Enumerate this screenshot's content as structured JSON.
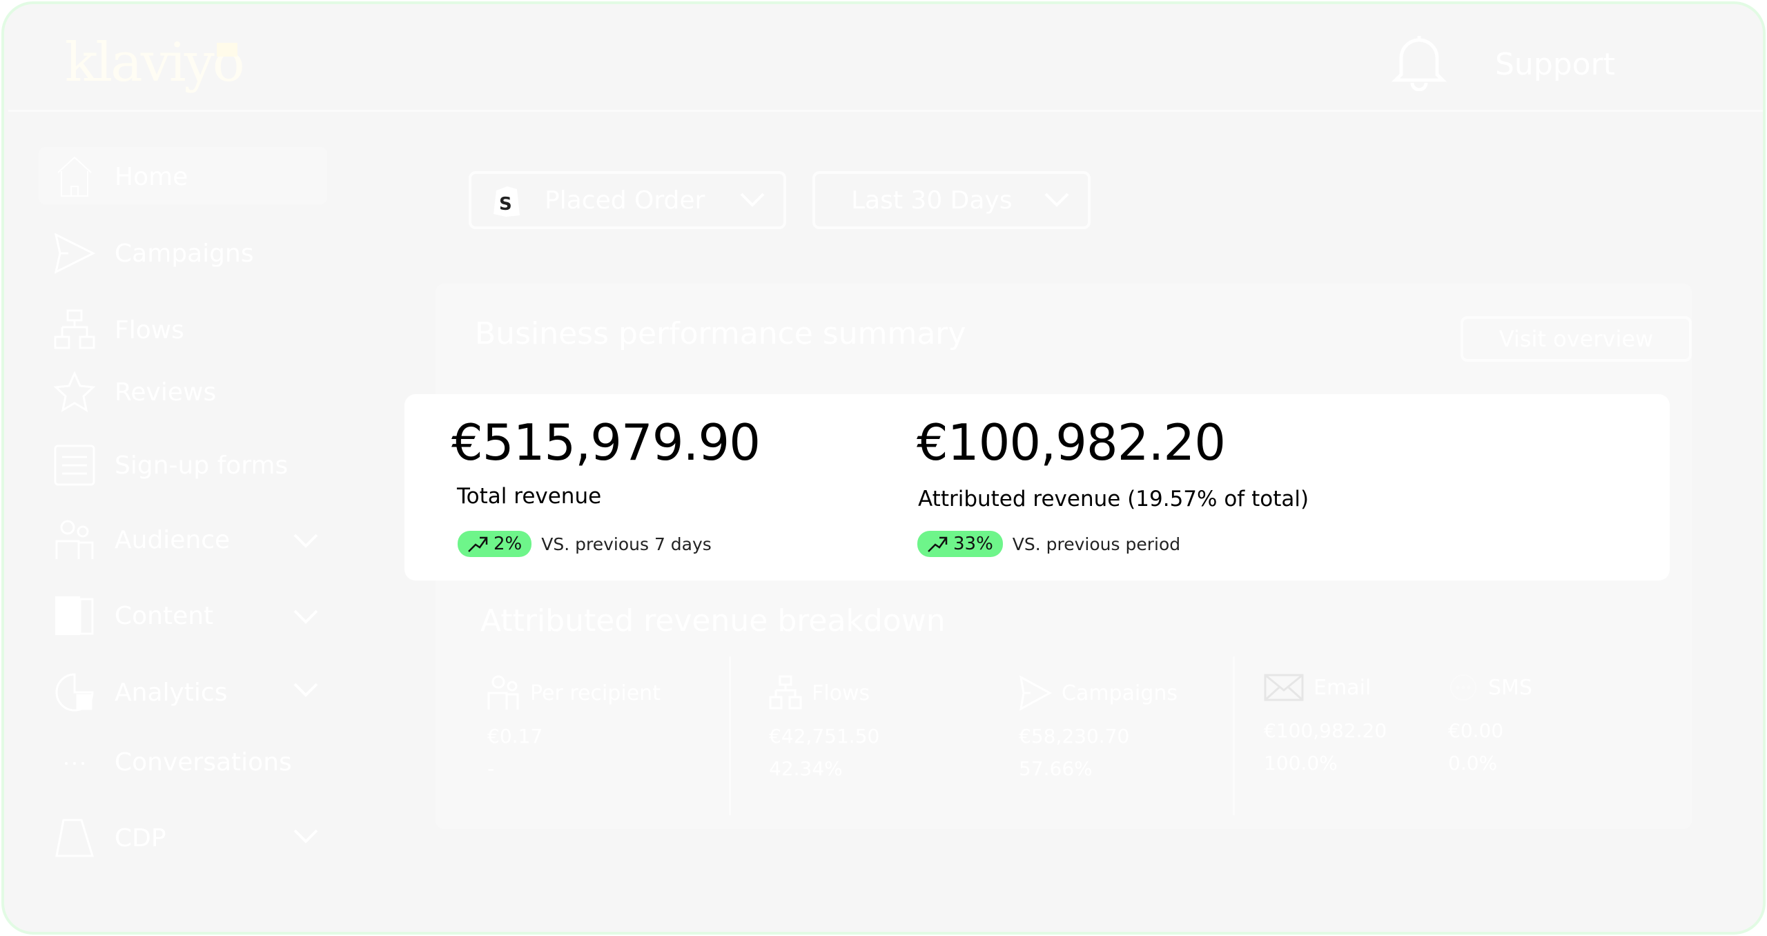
{
  "header": {
    "logo": "klaviyo",
    "support_label": "Support"
  },
  "sidebar": {
    "items": [
      {
        "label": "Home",
        "icon": "home-icon",
        "active": true
      },
      {
        "label": "Campaigns",
        "icon": "send-icon"
      },
      {
        "label": "Flows",
        "icon": "flows-icon"
      },
      {
        "label": "Reviews",
        "icon": "star-icon"
      },
      {
        "label": "Sign-up forms",
        "icon": "form-icon"
      },
      {
        "label": "Audience",
        "icon": "audience-icon",
        "expandable": true
      },
      {
        "label": "Content",
        "icon": "content-icon",
        "expandable": true
      },
      {
        "label": "Analytics",
        "icon": "analytics-icon",
        "expandable": true
      },
      {
        "label": "Conversations",
        "icon": "chat-icon"
      },
      {
        "label": "CDP",
        "icon": "cdp-icon",
        "expandable": true
      }
    ]
  },
  "filters": {
    "metric": "Placed Order",
    "metric_icon": "shopify-icon",
    "period": "Last 30 Days"
  },
  "summary": {
    "title": "Business performance summary",
    "visit_label": "Visit overview",
    "total": {
      "value": "€515,979.90",
      "label": "Total revenue",
      "change": "2%",
      "vs": "VS. previous 7 days"
    },
    "attributed": {
      "value": "€100,982.20",
      "label": "Attributed revenue (19.57% of total)",
      "change": "33%",
      "vs": "VS. previous period"
    },
    "badge_color": "#6ef58a"
  },
  "breakdown": {
    "title": "Attributed revenue breakdown",
    "columns": [
      {
        "label": "Per recipient",
        "icon": "audience-icon",
        "value": "€0.17",
        "pct": "-"
      },
      {
        "label": "Flows",
        "icon": "flows-icon",
        "value": "€42,751.50",
        "pct": "42.34%"
      },
      {
        "label": "Campaigns",
        "icon": "send-icon",
        "value": "€58,230.70",
        "pct": "57.66%"
      },
      {
        "label": "Email",
        "icon": "email-icon",
        "value": "€100,982.20",
        "pct": "100.0%"
      },
      {
        "label": "SMS",
        "icon": "sms-icon",
        "value": "€0.00",
        "pct": "0.0%"
      }
    ]
  }
}
